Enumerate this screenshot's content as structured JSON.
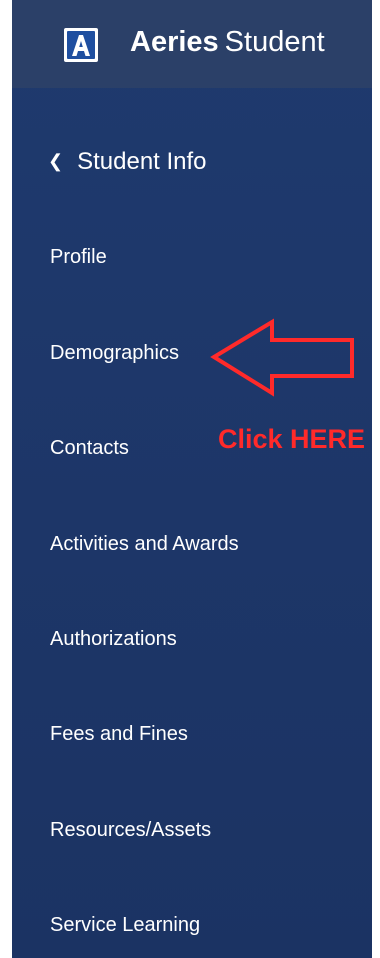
{
  "app": {
    "brand_strong": "Aeries",
    "brand_light": "Student",
    "logo_letter": "A",
    "icons": {
      "logo": "aeries-logo-icon",
      "back": "chevron-left-icon",
      "annotation": "red-arrow-icon"
    },
    "colors": {
      "sidebar": "#1f3a6e",
      "topbar": "#2b4068",
      "logo_blue": "#1f4fa0",
      "annotation_red": "#ff2a2a",
      "text": "#ffffff"
    }
  },
  "sidebar": {
    "back_label": "Student Info",
    "items": [
      {
        "label": "Profile"
      },
      {
        "label": "Demographics"
      },
      {
        "label": "Contacts"
      },
      {
        "label": "Activities and Awards"
      },
      {
        "label": "Authorizations"
      },
      {
        "label": "Fees and Fines"
      },
      {
        "label": "Resources/Assets"
      },
      {
        "label": "Service Learning"
      }
    ]
  },
  "annotation": {
    "text": "Click HERE"
  }
}
